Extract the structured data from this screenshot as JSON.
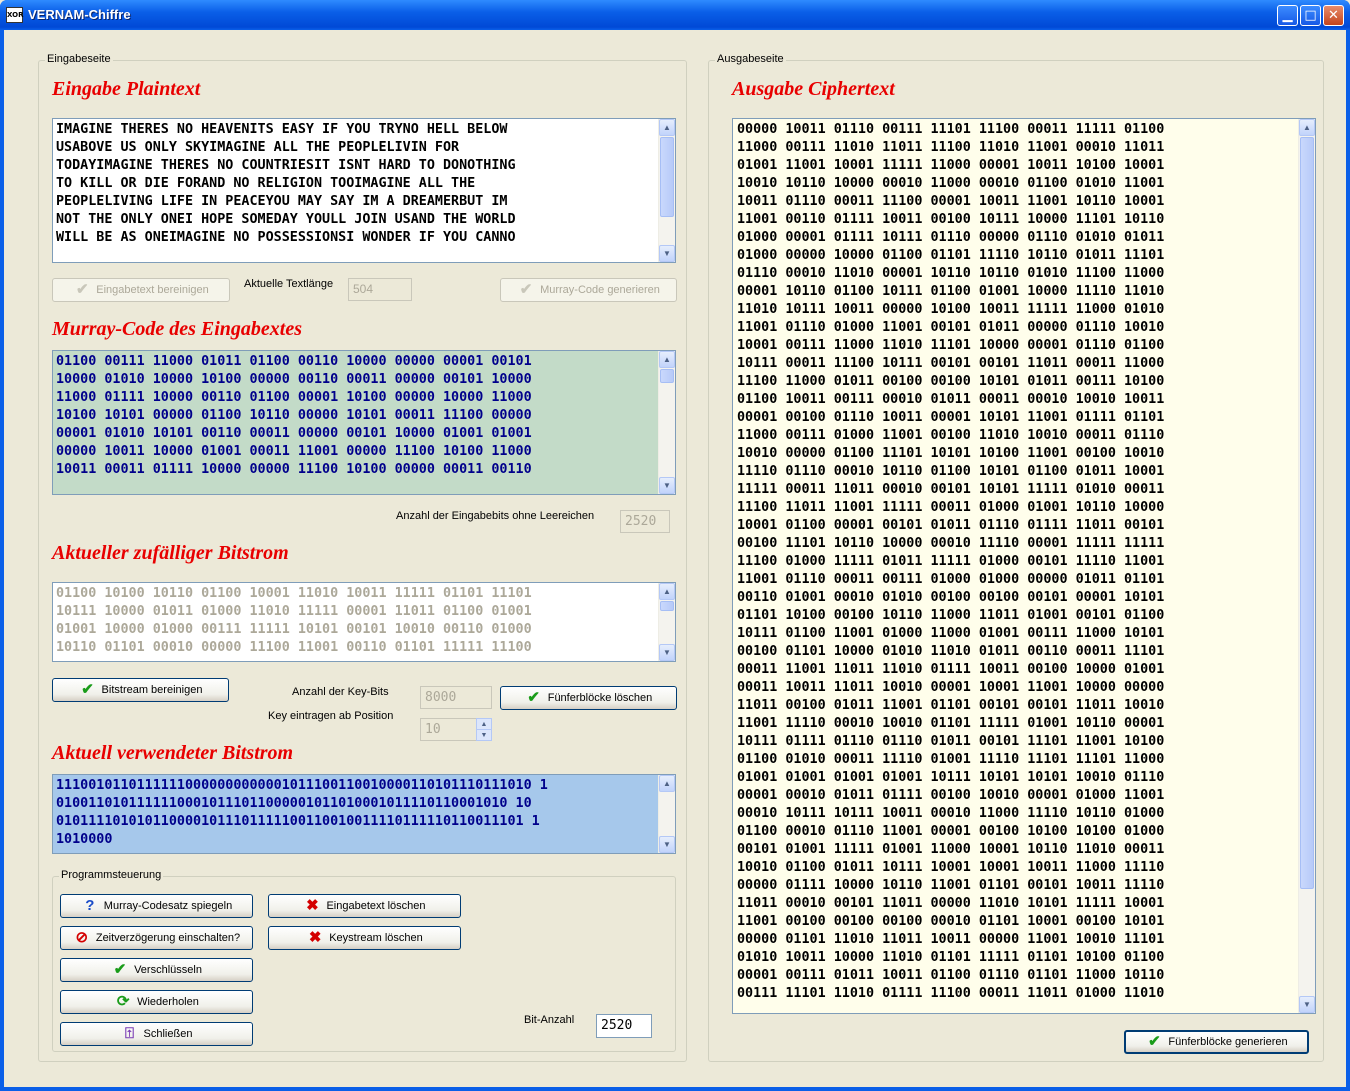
{
  "window": {
    "title": "VERNAM-Chiffre",
    "app_icon_text": "XOR",
    "minimize": "▁",
    "maximize": "□",
    "close": "✕"
  },
  "left": {
    "group_label": "Eingabeseite",
    "plaintext_heading": "Eingabe Plaintext",
    "plaintext": "IMAGINE THERES NO HEAVENITS EASY IF YOU TRYNO HELL BELOW\nUSABOVE US ONLY SKYIMAGINE ALL THE PEOPLELIVIN FOR\nTODAYIMAGINE THERES NO COUNTRIESIT ISNT HARD TO DONOTHING\nTO KILL OR DIE FORAND NO RELIGION TOOIMAGINE ALL THE\nPEOPLELIVING LIFE IN PEACEYOU MAY SAY IM A DREAMERBUT IM\nNOT THE ONLY ONEI HOPE SOMEDAY YOULL JOIN USAND THE WORLD\nWILL BE AS ONEIMAGINE NO POSSESSIONSI WONDER IF YOU CANNO",
    "clean_input_button": "Eingabetext bereinigen",
    "text_length_label": "Aktuelle Textlänge",
    "text_length_value": "504",
    "murray_generate_button": "Murray-Code generieren",
    "murray_heading": "Murray-Code des Eingabextes",
    "murray_code": "01100 00111 11000 01011 01100 00110 10000 00000 00001 00101\n10000 01010 10000 10100 00000 00110 00011 00000 00101 10000\n11000 01111 10000 00110 01100 00001 10100 00000 10000 11000\n10100 10101 00000 01100 10110 00000 10101 00011 11100 00000\n00001 01010 10101 00110 00011 00000 00101 10000 01001 01001\n00000 10011 10000 01001 00011 11001 00000 11100 10100 11000\n10011 00011 01111 10000 00000 11100 10100 00000 00011 00110",
    "input_bits_label": "Anzahl der Eingabebits ohne Leereichen",
    "input_bits_value": "2520",
    "random_heading": "Aktueller zufälliger Bitstrom",
    "random_bits": "01100 10100 10110 01100 10001 11010 10011 11111 01101 11101\n10111 10000 01011 01000 11010 11111 00001 11011 01100 01001\n01001 10000 01000 00111 11111 10101 00101 10010 00110 01000\n10110 01101 00010 00000 11100 11001 00110 01101 11111 11100",
    "bitstream_clean_button": "Bitstream bereinigen",
    "key_bits_label": "Anzahl der Key-Bits",
    "key_bits_value": "8000",
    "key_position_label": "Key eintragen ab Position",
    "key_position_value": "10",
    "delete_blocks_button": "Fünferblöcke löschen",
    "used_heading": "Aktuell verwendeter Bitstrom",
    "used_bits": "11100101101111110000000000001011100110010000110101110111010 1\n01001101011111100010111011000001011010001011110110001010 10\n0101111010101100001011101111100110010011110111110110011101 1\n1010000",
    "control_label": "Programmsteuerung",
    "mirror_button": "Murray-Codesatz spiegeln",
    "delay_button": "Zeitverzögerung einschalten?",
    "encrypt_button": "Verschlüsseln",
    "repeat_button": "Wiederholen",
    "close_button": "Schließen",
    "delete_input_button": "Eingabetext löschen",
    "delete_key_button": "Keystream löschen",
    "bit_count_label": "Bit-Anzahl",
    "bit_count_value": "2520"
  },
  "right": {
    "group_label": "Ausgabeseite",
    "cipher_heading": "Ausgabe Ciphertext",
    "ciphertext": "00000 10011 01110 00111 11101 11100 00011 11111 01100\n11000 00111 11010 11011 11100 11010 11001 00010 11011\n01001 11001 10001 11111 11000 00001 10011 10100 10001\n10010 10110 10000 00010 11000 00010 01100 01010 11001\n10011 01110 00011 11100 00001 10011 11001 10110 10001\n11001 00110 01111 10011 00100 10111 10000 11101 10110\n01000 00001 01111 10111 01110 00000 01110 01010 01011\n01000 00000 10000 01100 01101 11110 10110 01011 11101\n01110 00010 11010 00001 10110 10110 01010 11100 11000\n00001 10110 01100 10111 01100 01001 10000 11110 11010\n11010 10111 10011 00000 10100 10011 11111 11000 01010\n11001 01110 01000 11001 00101 01011 00000 01110 10010\n10001 00111 11000 11010 11101 10000 00001 01110 01100\n10111 00011 11100 10111 00101 00101 11011 00011 11000\n11100 11000 01011 00100 00100 10101 01011 00111 10100\n01100 10011 00111 00010 01011 00011 00010 10010 10011\n00001 00100 01110 10011 00001 10101 11001 01111 01101\n11000 00111 01000 11001 00100 11010 10010 00011 01110\n10010 00000 01100 11101 10101 10100 11001 00100 10010\n11110 01110 00010 10110 01100 10101 01100 01011 10001\n11111 00011 11011 00010 00101 10101 11111 01010 00011\n11100 11011 11001 11111 00011 01000 01001 10110 10000\n10001 01100 00001 00101 01011 01110 01111 11011 00101\n00100 11101 10110 10000 00010 11110 00001 11111 11111\n11100 01000 11111 01011 11111 01000 00101 11110 11001\n11001 01110 00011 00111 01000 01000 00000 01011 01101\n00110 01001 00010 01010 00100 00100 00101 00001 10101\n01101 10100 00100 10110 11000 11011 01001 00101 01100\n10111 01100 11001 01000 11000 01001 00111 11000 10101\n00100 01101 10000 01010 11010 01011 00110 00011 11101\n00011 11001 11011 11010 01111 10011 00100 10000 01001\n00011 10011 11011 10010 00001 10001 11001 10000 00000\n11011 00100 01011 11001 01101 00101 00101 11011 10010\n11001 11110 00010 10010 01101 11111 01001 10110 00001\n10111 01111 01110 01110 01011 00101 11101 11001 10100\n01100 01010 00011 11110 01001 11110 11101 11101 11000\n01001 01001 01001 01001 10111 10101 10101 10010 01110\n00001 00010 01011 01111 00100 10010 00001 01000 11001\n00010 10111 10111 10011 00010 11000 11110 10110 01000\n01100 00010 01110 11001 00001 00100 10100 10100 01000\n00101 01001 11111 01001 11000 10001 10110 11010 00011\n10010 01100 01011 10111 10001 10001 10011 11000 11110\n00000 01111 10000 10110 11001 01101 00101 10011 11110\n11011 00010 00101 11011 00000 11010 10101 11111 10001\n11001 00100 00100 00100 00010 01101 10001 00100 10101\n00000 01101 11010 11011 10011 00000 11001 10010 11101\n01010 10011 10000 11010 01101 11111 01101 10100 01100\n00001 00111 01011 10011 01100 01110 01101 11000 10110\n00111 11101 11010 01111 11100 00011 11011 01000 11010",
    "generate_blocks_button": "Fünferblöcke generieren"
  }
}
